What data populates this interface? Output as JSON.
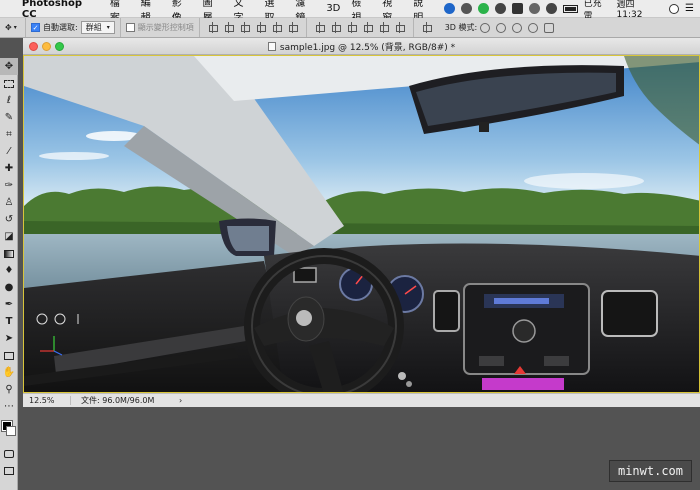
{
  "menubar": {
    "app_name": "Photoshop CC",
    "items": [
      "檔案",
      "編輯",
      "影像",
      "圖層",
      "文字",
      "選取",
      "濾鏡",
      "3D",
      "檢視",
      "視窗",
      "說明"
    ],
    "battery_status": "已充電",
    "clock": "週四 11:32"
  },
  "options_bar": {
    "auto_select_label": "自動選取:",
    "auto_select_checked": true,
    "auto_select_target": "群組",
    "transform_controls_label": "顯示變形控制項",
    "transform_controls_checked": false,
    "mode_3d_label": "3D 模式:"
  },
  "toolbar": {
    "tools": [
      "move-tool",
      "marquee-tool",
      "lasso-tool",
      "quick-select-tool",
      "crop-tool",
      "eyedropper-tool",
      "healing-brush-tool",
      "brush-tool",
      "clone-stamp-tool",
      "history-brush-tool",
      "eraser-tool",
      "gradient-tool",
      "blur-tool",
      "dodge-tool",
      "pen-tool",
      "type-tool",
      "path-select-tool",
      "rectangle-tool",
      "hand-tool",
      "zoom-tool",
      "edit-toolbar-tool"
    ],
    "foreground_color": "#000000",
    "background_color": "#ffffff"
  },
  "document": {
    "tab_title": "sample1.jpg @ 12.5% (背景, RGB/8#) *",
    "zoom": "12.5%",
    "file_info": "文件: 96.0M/96.0M"
  },
  "watermark": "minwt.com"
}
